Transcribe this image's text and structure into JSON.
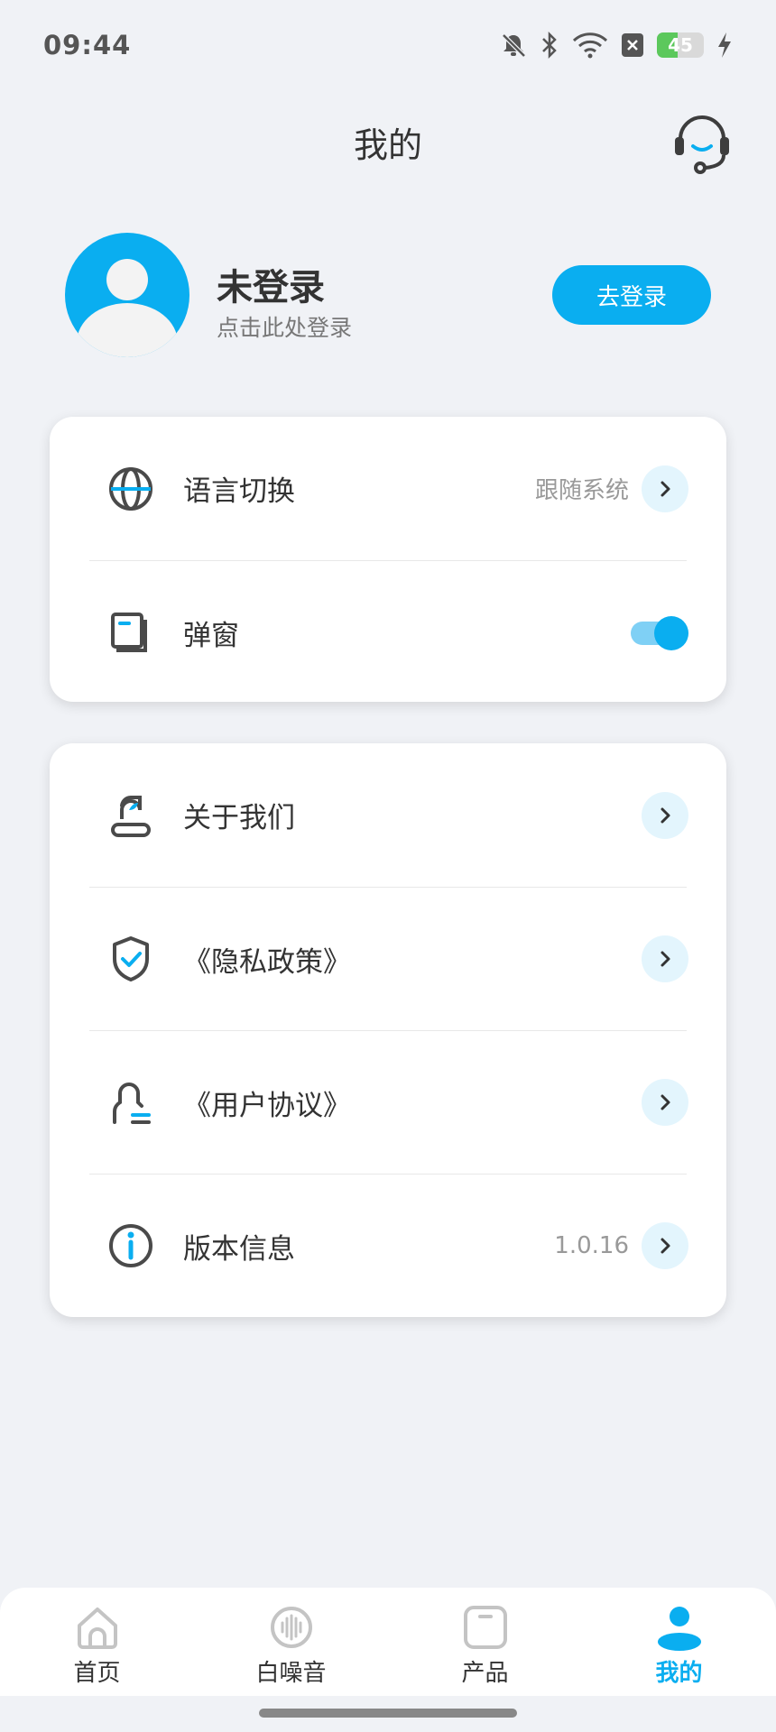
{
  "status_bar": {
    "time": "09:44",
    "battery": "45"
  },
  "header": {
    "title": "我的"
  },
  "profile": {
    "name": "未登录",
    "subtitle": "点击此处登录",
    "login_label": "去登录"
  },
  "settings": {
    "language": {
      "label": "语言切换",
      "value": "跟随系统"
    },
    "popup": {
      "label": "弹窗",
      "enabled": true
    }
  },
  "info": {
    "about": {
      "label": "关于我们"
    },
    "privacy": {
      "label": "《隐私政策》"
    },
    "agreement": {
      "label": "《用户协议》"
    },
    "version": {
      "label": "版本信息",
      "value": "1.0.16"
    }
  },
  "nav": {
    "items": [
      {
        "label": "首页",
        "icon": "home-icon"
      },
      {
        "label": "白噪音",
        "icon": "white-noise-icon"
      },
      {
        "label": "产品",
        "icon": "product-icon"
      },
      {
        "label": "我的",
        "icon": "profile-icon"
      }
    ],
    "active": "我的"
  },
  "colors": {
    "accent": "#0aaef0",
    "background": "#f0f2f6",
    "icon": "#4a4a4a"
  }
}
